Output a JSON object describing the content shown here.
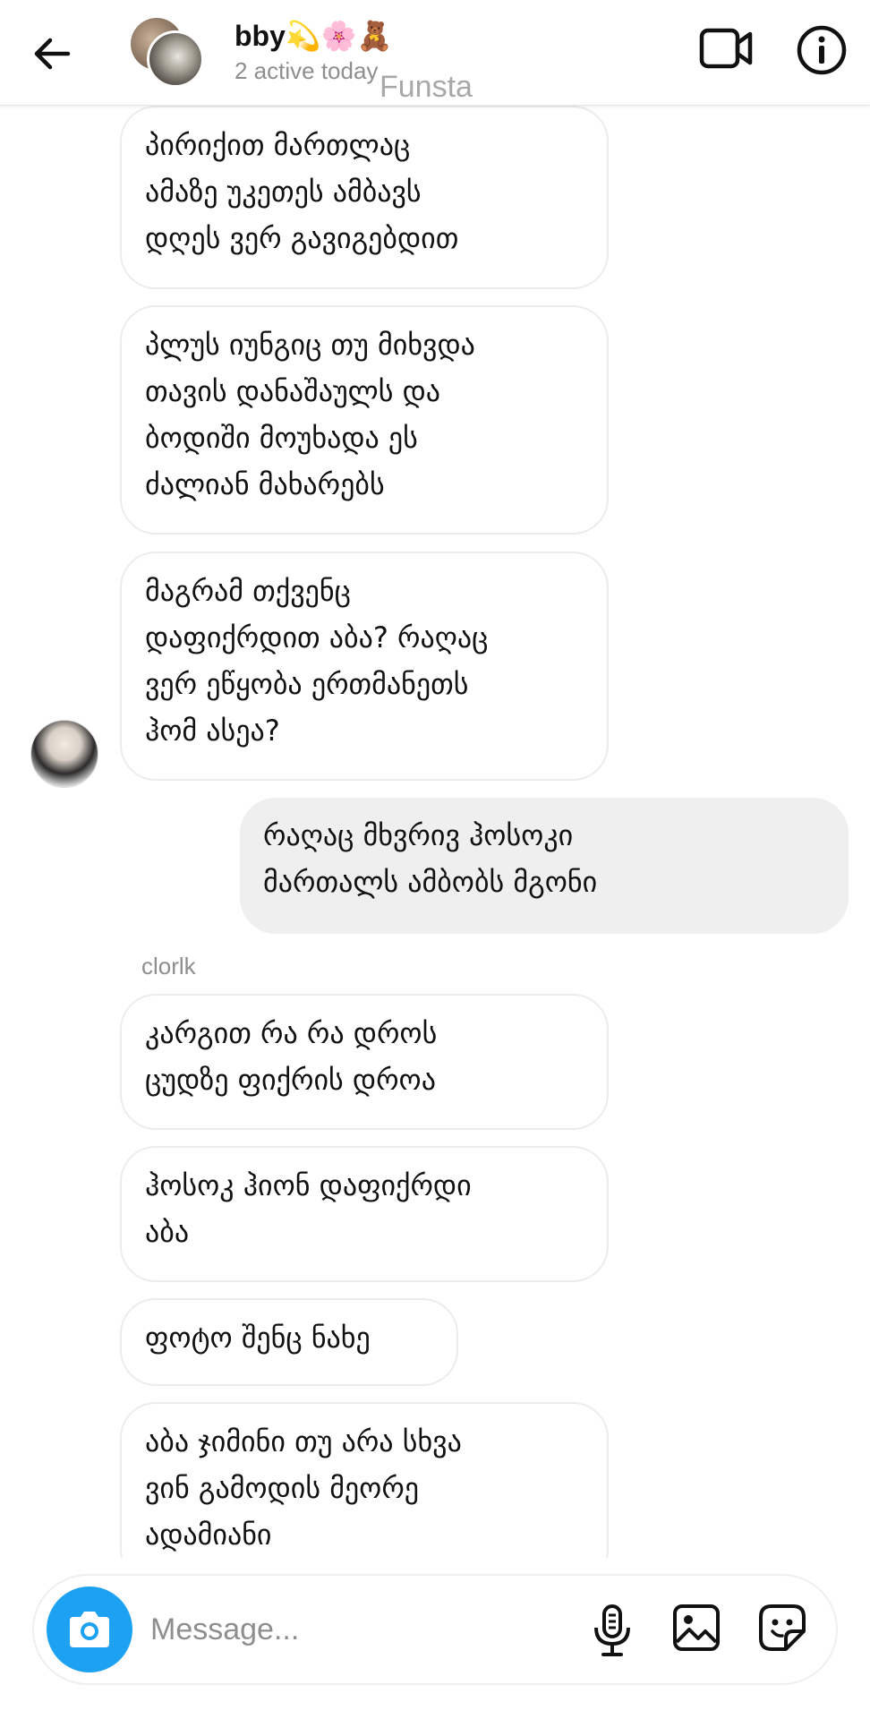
{
  "header": {
    "title": "bby💫🌸🧸",
    "subtitle": "2 active today",
    "watermark": "Funsta",
    "icons": {
      "back": "arrow-left-icon",
      "video": "video-camera-icon",
      "info": "info-icon"
    }
  },
  "chat": {
    "messages": [
      {
        "direction": "incoming",
        "text": "პირიქით მართლაც\nამაზე უკეთეს ამბავს\nდღეს ვერ გავიგებდით"
      },
      {
        "direction": "incoming",
        "text": "პლუს იუნგიც თუ მიხვდა\nთავის დანაშაულს და\nბოდიში მოუხადა ეს\nძალიან მახარებს"
      },
      {
        "direction": "incoming",
        "text": "მაგრამ თქვენც\nდაფიქრდით აბა? რაღაც\nვერ ეწყობა ერთმანეთს\nჰომ ასეა?"
      },
      {
        "direction": "outgoing",
        "text": "რაღაც მხვრივ ჰოსოკი\nმართალს ამბობს მგონი"
      },
      {
        "direction": "incoming",
        "text": "კარგით რა რა დროს\nცუდზე ფიქრის დროა"
      },
      {
        "direction": "incoming",
        "text": "ჰოსოკ ჰიონ დაფიქრდი\nაბა"
      },
      {
        "direction": "incoming",
        "text": "ფოტო შენც ნახე"
      },
      {
        "direction": "incoming",
        "text": "აბა ჯიმინი თუ არა სხვა\nვინ გამოდის მეორე\nადამიანი"
      }
    ],
    "sender_name": "clorlk"
  },
  "composer": {
    "placeholder": "Message...",
    "accent_color": "#1da1f2",
    "icons": {
      "camera": "camera-icon",
      "mic": "microphone-icon",
      "gallery": "image-icon",
      "sticker": "sticker-icon"
    }
  }
}
